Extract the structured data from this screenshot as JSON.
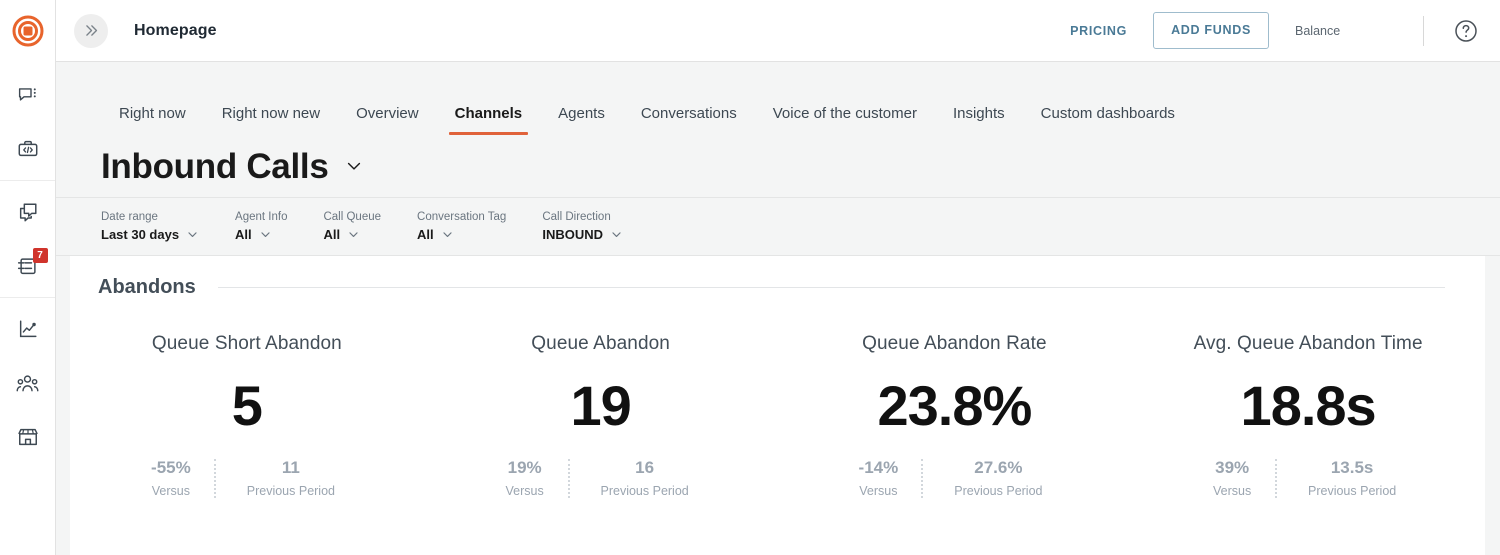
{
  "brand": {
    "logo_icon": "target-logo-icon",
    "accent_color": "#e0623a",
    "badge_color": "#d0342c",
    "link_color": "#4a7a96"
  },
  "rail": {
    "groups": [
      {
        "items": [
          {
            "icon": "chat-menu-icon",
            "name": "sidebar-item-chat"
          },
          {
            "icon": "briefcase-code-icon",
            "name": "sidebar-item-developer"
          }
        ]
      },
      {
        "items": [
          {
            "icon": "conversations-copy-icon",
            "name": "sidebar-item-conversations"
          },
          {
            "icon": "inbox-archive-icon",
            "name": "sidebar-item-inbox",
            "badge": "7"
          }
        ]
      },
      {
        "items": [
          {
            "icon": "analytics-chart-icon",
            "name": "sidebar-item-analytics"
          },
          {
            "icon": "team-people-icon",
            "name": "sidebar-item-team"
          },
          {
            "icon": "storefront-icon",
            "name": "sidebar-item-marketplace"
          }
        ]
      }
    ]
  },
  "topbar": {
    "expand_icon": "double-chevron-right-icon",
    "breadcrumb": "Homepage",
    "pricing_label": "PRICING",
    "add_funds_label": "ADD FUNDS",
    "balance_label": "Balance",
    "balance_value": "",
    "help_icon": "question-circle-icon"
  },
  "tabs": [
    {
      "label": "Right now",
      "active": false
    },
    {
      "label": "Right now new",
      "active": false
    },
    {
      "label": "Overview",
      "active": false
    },
    {
      "label": "Channels",
      "active": true
    },
    {
      "label": "Agents",
      "active": false
    },
    {
      "label": "Conversations",
      "active": false
    },
    {
      "label": "Voice of the customer",
      "active": false
    },
    {
      "label": "Insights",
      "active": false
    },
    {
      "label": "Custom dashboards",
      "active": false
    }
  ],
  "page": {
    "title": "Inbound Calls",
    "title_caret_icon": "chevron-down-icon"
  },
  "filters": [
    {
      "label": "Date range",
      "value": "Last 30 days",
      "caret_icon": "chevron-down-icon"
    },
    {
      "label": "Agent Info",
      "value": "All",
      "caret_icon": "chevron-down-icon"
    },
    {
      "label": "Call Queue",
      "value": "All",
      "caret_icon": "chevron-down-icon"
    },
    {
      "label": "Conversation Tag",
      "value": "All",
      "caret_icon": "chevron-down-icon"
    },
    {
      "label": "Call Direction",
      "value": "INBOUND",
      "caret_icon": "chevron-down-icon"
    }
  ],
  "section": {
    "title": "Abandons"
  },
  "metric_footer_labels": {
    "versus": "Versus",
    "previous_period": "Previous Period"
  },
  "cards": [
    {
      "title": "Queue Short Abandon",
      "value": "5",
      "delta": "-55%",
      "delta_label": "Versus",
      "previous": "11",
      "previous_label": "Previous Period"
    },
    {
      "title": "Queue Abandon",
      "value": "19",
      "delta": "19%",
      "delta_label": "Versus",
      "previous": "16",
      "previous_label": "Previous Period"
    },
    {
      "title": "Queue Abandon Rate",
      "value": "23.8%",
      "delta": "-14%",
      "delta_label": "Versus",
      "previous": "27.6%",
      "previous_label": "Previous Period"
    },
    {
      "title": "Avg. Queue Abandon Time",
      "value": "18.8s",
      "delta": "39%",
      "delta_label": "Versus",
      "previous": "13.5s",
      "previous_label": "Previous Period"
    }
  ]
}
